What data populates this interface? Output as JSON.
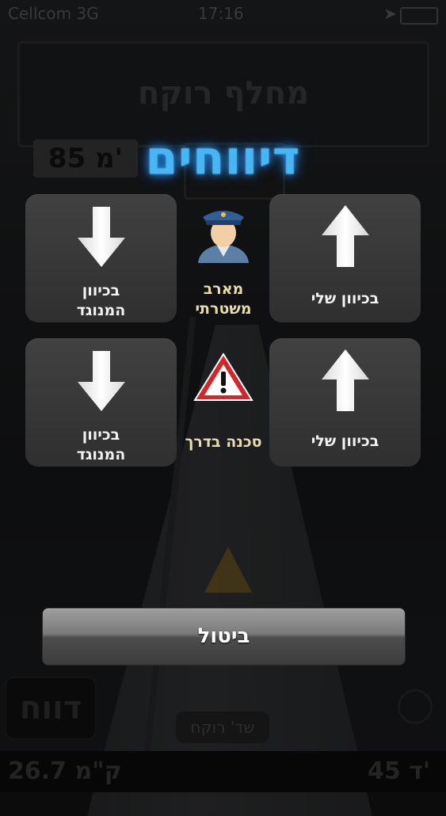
{
  "status_bar": {
    "carrier": "Cellcom 3G",
    "time": "17:16"
  },
  "background": {
    "street_name": "מחלף רוקח",
    "distance": "85 מ'",
    "report_button": "דווח",
    "bottom_street": "שד' רוקח",
    "bottom_left_distance": "26.7 ק\"מ",
    "bottom_right_time": "45 ד'"
  },
  "dialog": {
    "title": "דיווחים",
    "tiles": {
      "police_my_direction": "בכיוון שלי",
      "police_opposite": [
        "בכיוון",
        "המנוגד"
      ],
      "hazard_my_direction": "בכיוון שלי",
      "hazard_opposite": [
        "בכיוון",
        "המנוגד"
      ]
    },
    "police_label": [
      "מארב",
      "משטרתי"
    ],
    "hazard_label": "סכנה בדרך",
    "cancel_label": "ביטול"
  },
  "colors": {
    "title_glow": "#47b6f2",
    "tile_bg": "#3a3a3a",
    "center_label": "#e8dcae"
  },
  "icons": {
    "up_arrow": "arrow-up-icon",
    "down_arrow": "arrow-down-icon",
    "police": "police-officer-icon",
    "hazard": "warning-triangle-icon"
  }
}
